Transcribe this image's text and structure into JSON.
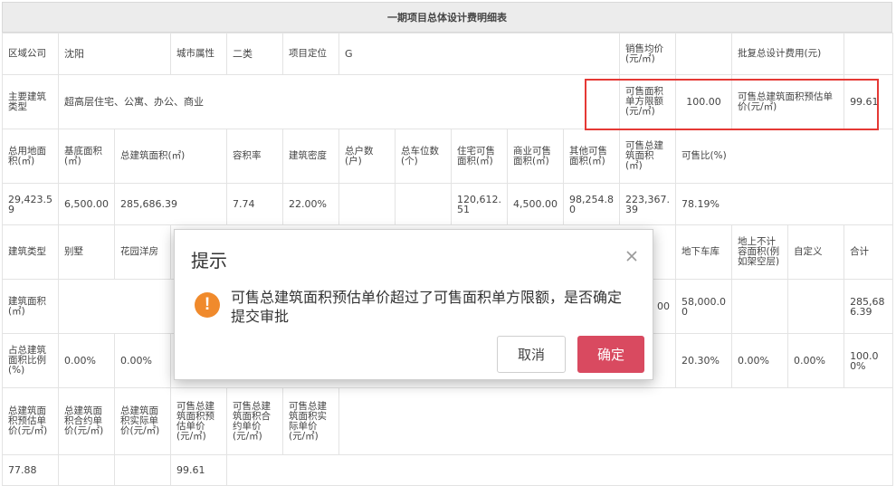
{
  "table": {
    "title": "一期项目总体设计费明细表",
    "row1": {
      "region_label": "区域公司",
      "region_value": "沈阳",
      "city_label": "城市属性",
      "city_value": "二类",
      "position_label": "项目定位",
      "position_value": "G",
      "avg_price_label": "销售均价(元/㎡)",
      "approved_fee_label": "批复总设计费用(元)"
    },
    "row2": {
      "building_type_label": "主要建筑类型",
      "building_type_value": "超高层住宅、公寓、办公、商业",
      "unit_limit_label": "可售面积单方限额(元/㎡)",
      "unit_limit_value": "100.00",
      "est_unit_price_label": "可售总建筑面积预估单价(元/㎡)",
      "est_unit_price_value": "99.61"
    },
    "row3_headers": [
      "总用地面积(㎡)",
      "基底面积(㎡)",
      "总建筑面积(㎡)",
      "容积率",
      "建筑密度",
      "总户数(户)",
      "总车位数(个)",
      "住宅可售面积(㎡)",
      "商业可售面积(㎡)",
      "其他可售面积(㎡)",
      "可售总建筑面积(㎡)",
      "可售比(%)"
    ],
    "row4_values": {
      "total_land": "29,423.59",
      "base_area": "6,500.00",
      "total_building": "285,686.39",
      "far": "7.74",
      "density": "22.00%",
      "res_sale": "120,612.51",
      "com_sale": "4,500.00",
      "other_sale": "98,254.80",
      "total_sale": "223,367.39",
      "sale_ratio": "78.19%"
    },
    "row5": {
      "type_label": "建筑类型",
      "villa": "别墅",
      "garden": "花园洋房",
      "parking": "地下车库",
      "uncounted": "地上不计容面积(例如架空层)",
      "custom": "自定义",
      "total": "合计"
    },
    "row6": {
      "label": "建筑面积(㎡)",
      "partial": "00",
      "parking": "58,000.00",
      "total": "285,686.39"
    },
    "row7": {
      "label": "占总建筑面积比例(%)",
      "villa": "0.00%",
      "garden": "0.00%",
      "parking": "20.30%",
      "uncounted": "0.00%",
      "custom": "0.00%",
      "total": "100.00%"
    },
    "row8_headers": [
      "总建筑面积预估单价(元/㎡)",
      "总建筑面积合约单价(元/㎡)",
      "总建筑面积实际单价(元/㎡)",
      "可售总建筑面积预估单价(元/㎡)",
      "可售总建筑面积合约单价(元/㎡)",
      "可售总建筑面积实际单价(元/㎡)"
    ],
    "row9": {
      "total_est": "77.88",
      "sale_est": "99.61"
    }
  },
  "dialog": {
    "title": "提示",
    "close_icon": "close-icon",
    "warning_icon": "exclamation-circle-icon",
    "warning_glyph": "!",
    "message": "可售总建筑面积预估单价超过了可售面积单方限额，是否确定提交审批",
    "cancel_label": "取消",
    "confirm_label": "确定"
  },
  "colors": {
    "highlight": "#e53935",
    "confirm_button": "#d94a60",
    "warning_icon": "#f08a2c"
  }
}
